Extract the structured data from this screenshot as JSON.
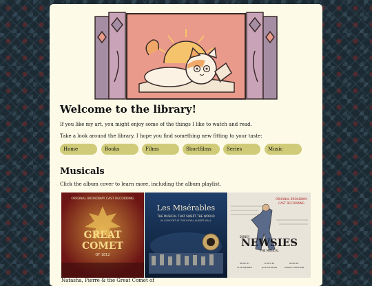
{
  "heading": "Welcome to the library!",
  "intro_line_1": "If you like my art, you might enjoy some of the things I like to watch and read.",
  "intro_line_2": "Take a look around the library, I hope you find something new fitting to your taste:",
  "nav": [
    "Home",
    "Books",
    "Films",
    "Shortfilms",
    "Series",
    "Music"
  ],
  "section_title": "Musicals",
  "section_note": "Click the album cover to learn more, including the album playlist.",
  "albums": [
    {
      "title_top": "ORIGINAL BROADWAY CAST RECORDING",
      "title_main_1": "GREAT",
      "title_main_2": "COMET",
      "title_sub": "OF 1812",
      "caption": "Natasha, Pierre & the Great Comet of"
    },
    {
      "title_main": "Les Misérables",
      "title_sub_1": "THE MUSICAL THAT SWEPT THE WORLD",
      "title_sub_2": "IN CONCERT AT THE ROYAL ALBERT HALL"
    },
    {
      "title_top_1": "ORIGINAL BROADWAY",
      "title_top_2": "CAST RECORDING",
      "title_brand": "DISNEY",
      "title_main": "NEWSIES",
      "title_sub": "THE MUSICAL",
      "credits": [
        "MUSIC BY",
        "ALAN MENKEN",
        "LYRICS BY",
        "JACK FELDMAN",
        "BOOK BY",
        "HARVEY FIERSTEIN"
      ]
    }
  ],
  "colors": {
    "page_background": "#1c2a33",
    "card_background": "#fdfbe8",
    "nav_pill": "#cfcb78",
    "banner_pink": "#e99a8a",
    "banner_purple": "#a58ea4"
  },
  "icons": [
    "cat-reading-illustration"
  ]
}
